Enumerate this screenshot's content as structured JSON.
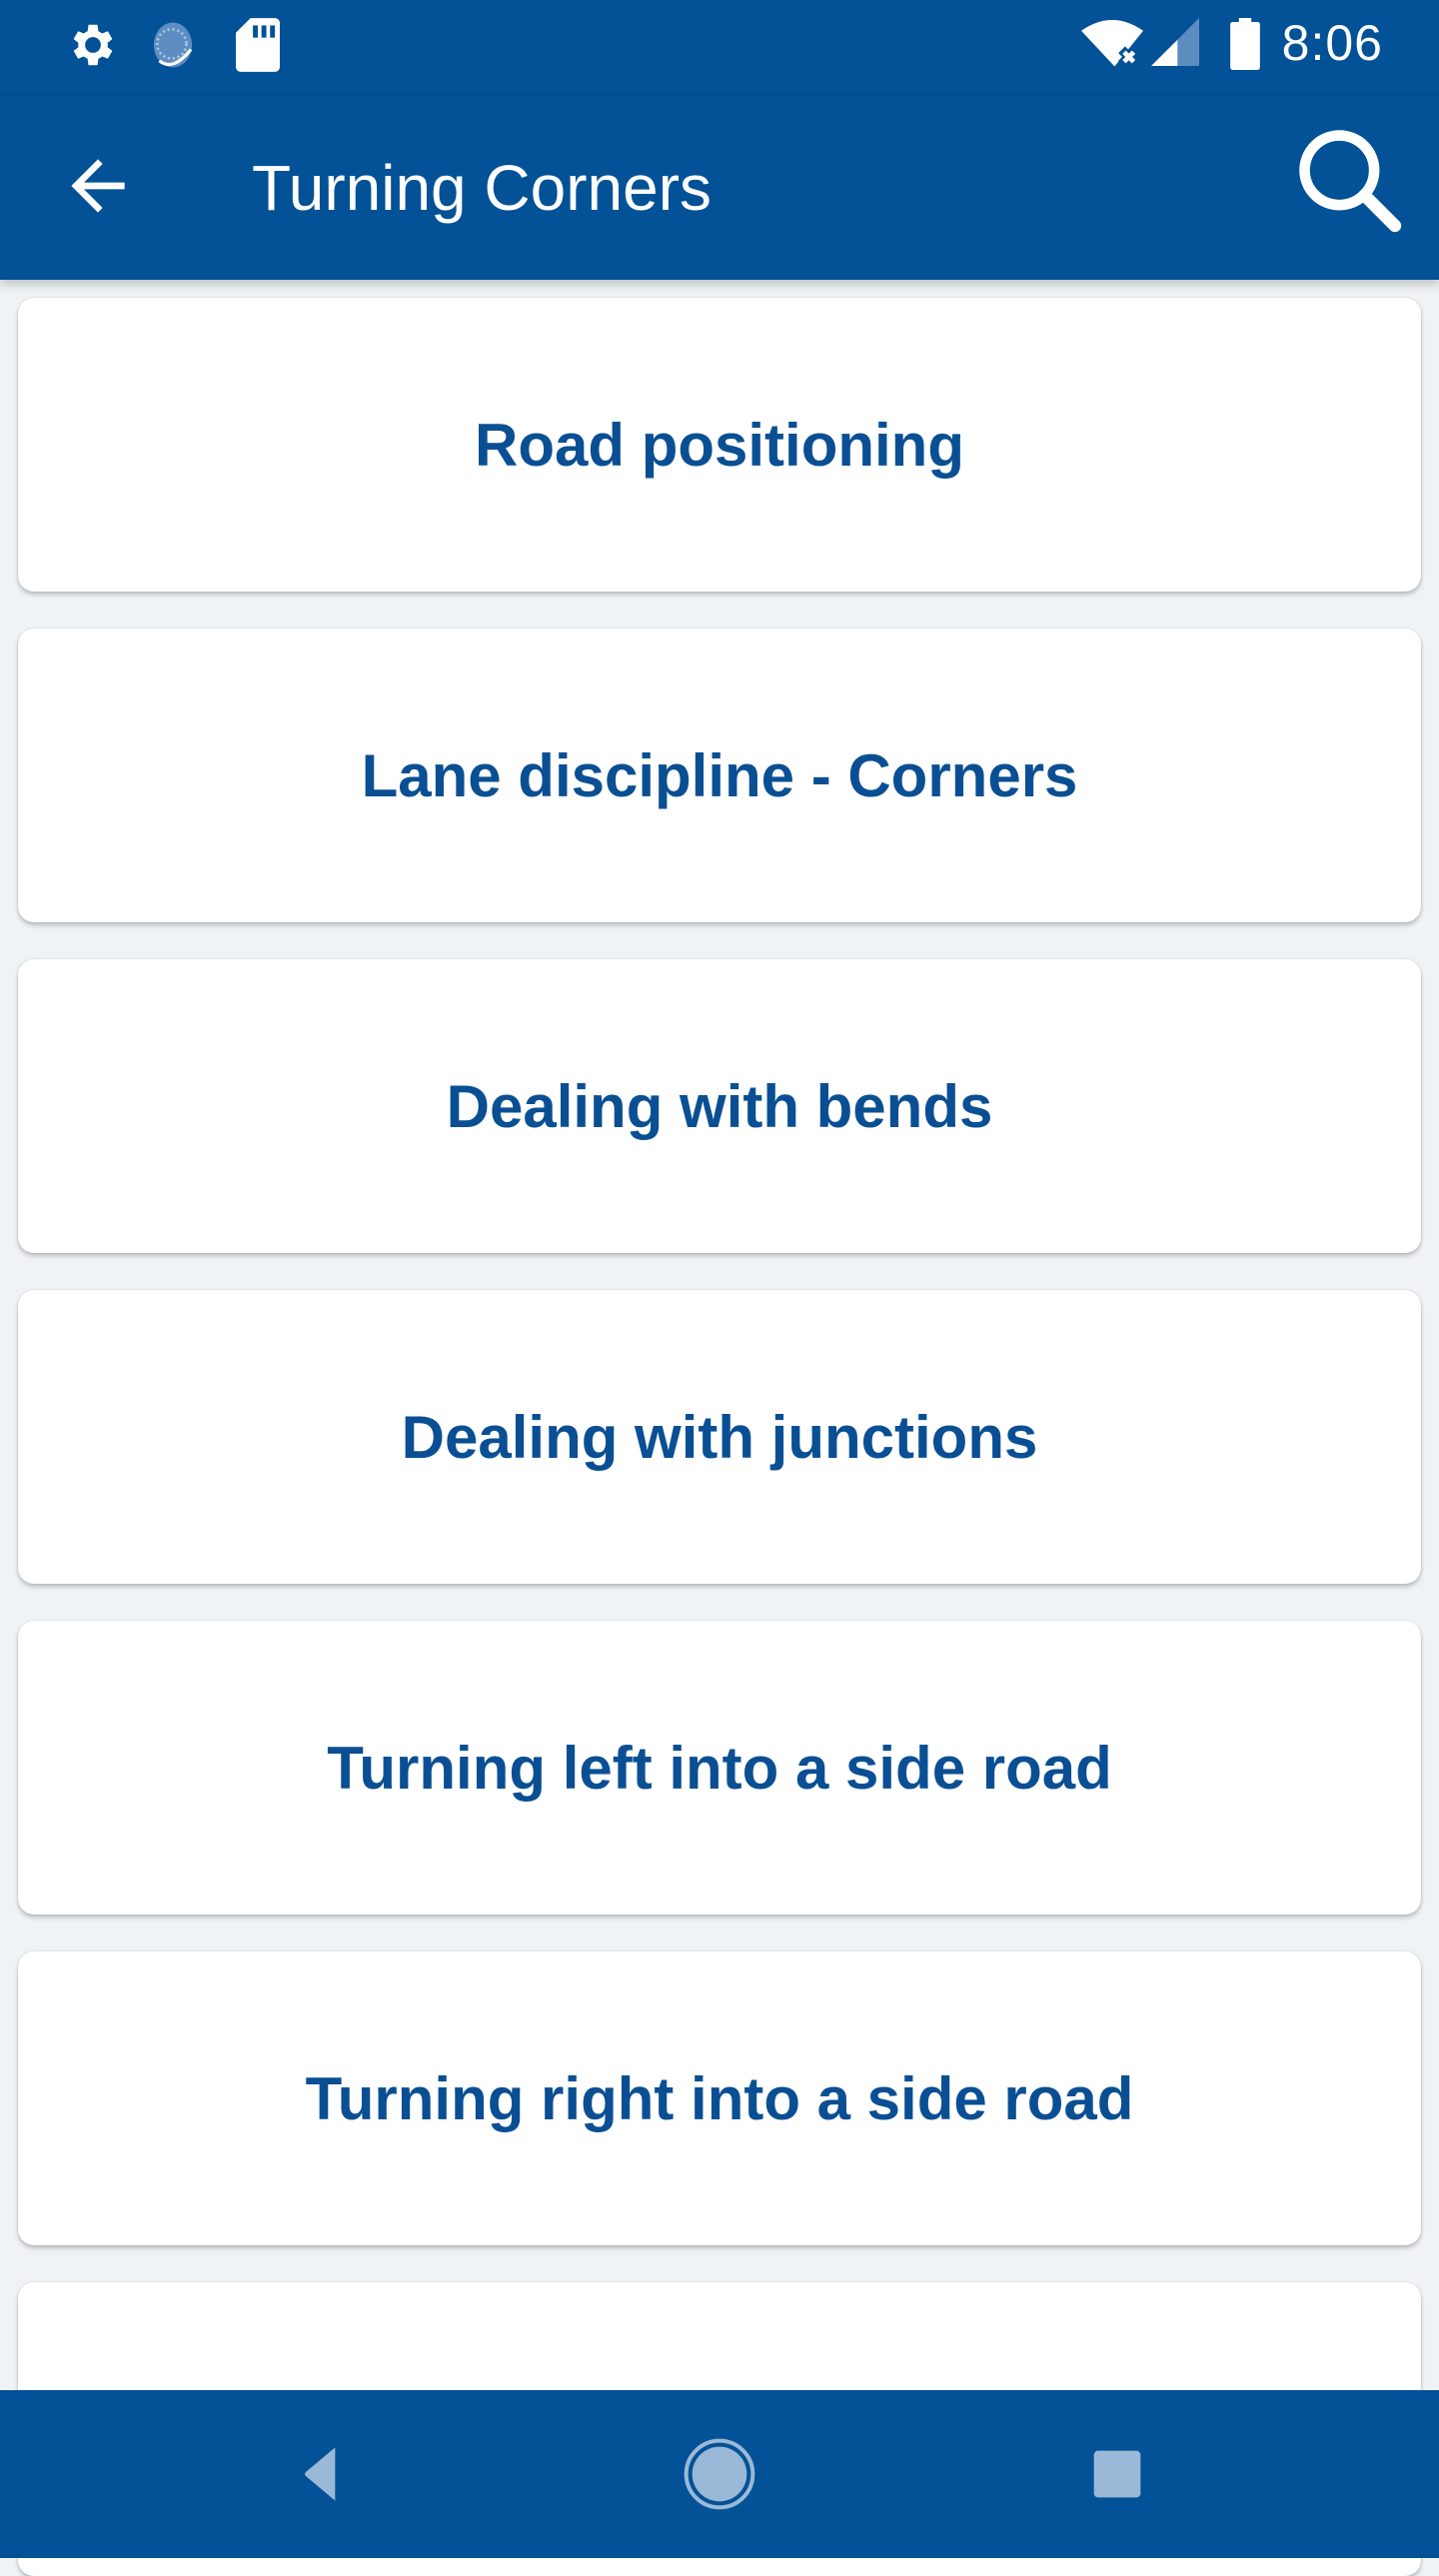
{
  "status_bar": {
    "time": "8:06",
    "left_icons": [
      "settings-icon",
      "sync-icon",
      "sd-card-icon"
    ],
    "right_icons": [
      "wifi-off-icon",
      "cellular-signal-icon",
      "battery-icon"
    ]
  },
  "app_bar": {
    "title": "Turning Corners",
    "back_icon": "arrow-back-icon",
    "search_icon": "search-icon"
  },
  "topics": [
    {
      "label": "Road positioning"
    },
    {
      "label": "Lane discipline - Corners"
    },
    {
      "label": "Dealing with bends"
    },
    {
      "label": "Dealing with junctions"
    },
    {
      "label": "Turning left into a side road"
    },
    {
      "label": "Turning right into a side road"
    },
    {
      "label": ""
    }
  ],
  "nav_bar": {
    "buttons": [
      "nav-back-icon",
      "nav-home-icon",
      "nav-recents-icon"
    ]
  },
  "colors": {
    "primary": "#035196",
    "text_accent": "#0a4f93",
    "background": "#eff3f6",
    "card": "#ffffff"
  }
}
